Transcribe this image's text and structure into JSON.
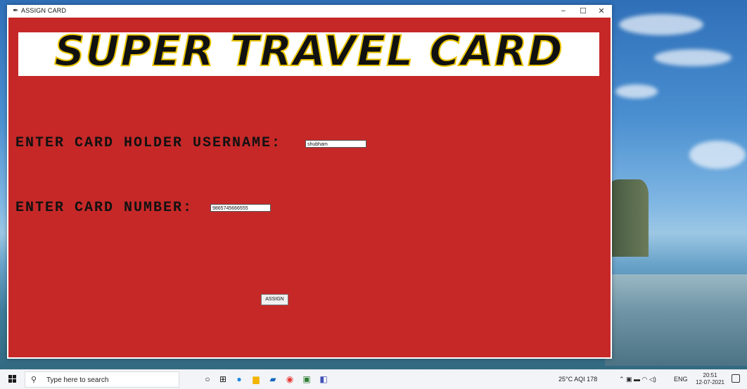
{
  "window": {
    "title": "ASSIGN CARD",
    "controls": {
      "minimize": "−",
      "maximize": "☐",
      "close": "✕"
    }
  },
  "banner": {
    "text": "SUPER TRAVEL CARD"
  },
  "form": {
    "username_label": "ENTER CARD HOLDER USERNAME:",
    "username_value": "shubham",
    "card_label": "ENTER CARD NUMBER:",
    "card_value": "9865745666555",
    "assign_label": "ASSIGN"
  },
  "taskbar": {
    "search_placeholder": "Type here to search",
    "weather": "25°C AQI 178",
    "lang": "ENG",
    "time": "20:51",
    "date": "12-07-2021",
    "icons": [
      "start-icon",
      "search-icon",
      "task-view-icon",
      "widgets-icon",
      "edge-icon",
      "file-explorer-icon",
      "mail-icon",
      "chrome-icon",
      "photos-icon",
      "python-icon"
    ]
  },
  "colors": {
    "client_bg": "#c62828",
    "banner_stroke": "#e9c400"
  }
}
